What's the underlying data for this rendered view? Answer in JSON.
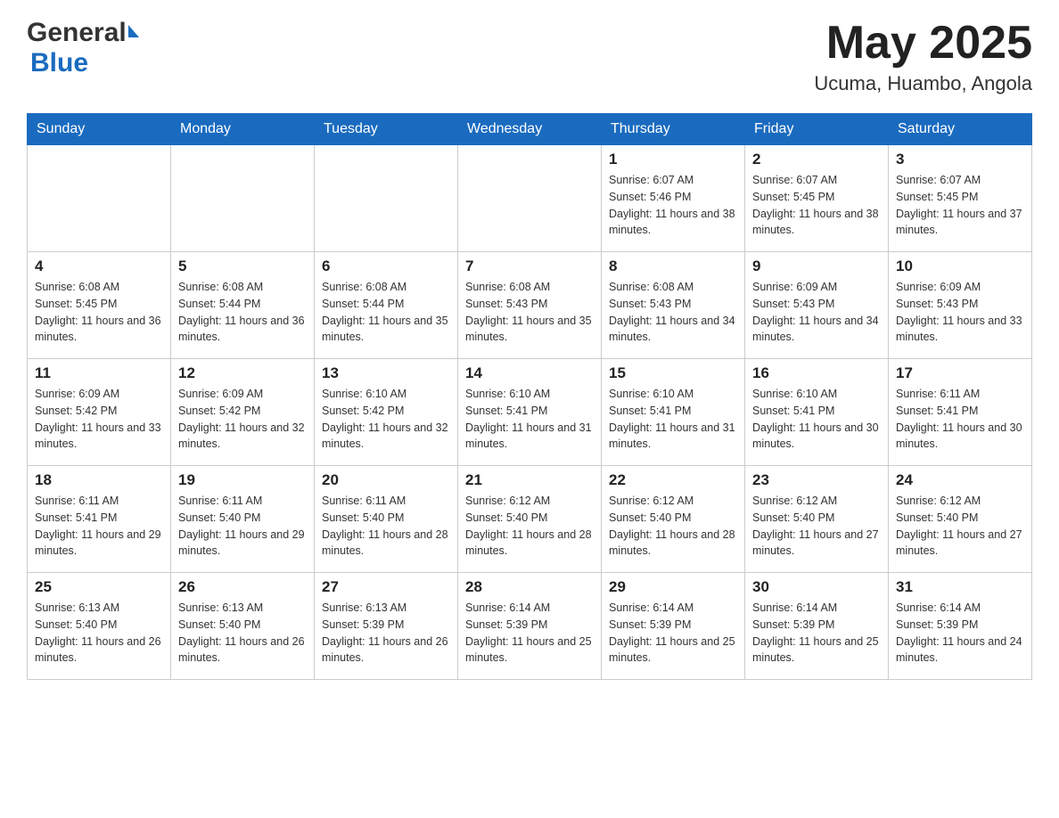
{
  "header": {
    "logo_general": "General",
    "logo_blue": "Blue",
    "month_title": "May 2025",
    "location": "Ucuma, Huambo, Angola"
  },
  "weekdays": [
    "Sunday",
    "Monday",
    "Tuesday",
    "Wednesday",
    "Thursday",
    "Friday",
    "Saturday"
  ],
  "weeks": [
    [
      {
        "day": "",
        "sunrise": "",
        "sunset": "",
        "daylight": ""
      },
      {
        "day": "",
        "sunrise": "",
        "sunset": "",
        "daylight": ""
      },
      {
        "day": "",
        "sunrise": "",
        "sunset": "",
        "daylight": ""
      },
      {
        "day": "",
        "sunrise": "",
        "sunset": "",
        "daylight": ""
      },
      {
        "day": "1",
        "sunrise": "Sunrise: 6:07 AM",
        "sunset": "Sunset: 5:46 PM",
        "daylight": "Daylight: 11 hours and 38 minutes."
      },
      {
        "day": "2",
        "sunrise": "Sunrise: 6:07 AM",
        "sunset": "Sunset: 5:45 PM",
        "daylight": "Daylight: 11 hours and 38 minutes."
      },
      {
        "day": "3",
        "sunrise": "Sunrise: 6:07 AM",
        "sunset": "Sunset: 5:45 PM",
        "daylight": "Daylight: 11 hours and 37 minutes."
      }
    ],
    [
      {
        "day": "4",
        "sunrise": "Sunrise: 6:08 AM",
        "sunset": "Sunset: 5:45 PM",
        "daylight": "Daylight: 11 hours and 36 minutes."
      },
      {
        "day": "5",
        "sunrise": "Sunrise: 6:08 AM",
        "sunset": "Sunset: 5:44 PM",
        "daylight": "Daylight: 11 hours and 36 minutes."
      },
      {
        "day": "6",
        "sunrise": "Sunrise: 6:08 AM",
        "sunset": "Sunset: 5:44 PM",
        "daylight": "Daylight: 11 hours and 35 minutes."
      },
      {
        "day": "7",
        "sunrise": "Sunrise: 6:08 AM",
        "sunset": "Sunset: 5:43 PM",
        "daylight": "Daylight: 11 hours and 35 minutes."
      },
      {
        "day": "8",
        "sunrise": "Sunrise: 6:08 AM",
        "sunset": "Sunset: 5:43 PM",
        "daylight": "Daylight: 11 hours and 34 minutes."
      },
      {
        "day": "9",
        "sunrise": "Sunrise: 6:09 AM",
        "sunset": "Sunset: 5:43 PM",
        "daylight": "Daylight: 11 hours and 34 minutes."
      },
      {
        "day": "10",
        "sunrise": "Sunrise: 6:09 AM",
        "sunset": "Sunset: 5:43 PM",
        "daylight": "Daylight: 11 hours and 33 minutes."
      }
    ],
    [
      {
        "day": "11",
        "sunrise": "Sunrise: 6:09 AM",
        "sunset": "Sunset: 5:42 PM",
        "daylight": "Daylight: 11 hours and 33 minutes."
      },
      {
        "day": "12",
        "sunrise": "Sunrise: 6:09 AM",
        "sunset": "Sunset: 5:42 PM",
        "daylight": "Daylight: 11 hours and 32 minutes."
      },
      {
        "day": "13",
        "sunrise": "Sunrise: 6:10 AM",
        "sunset": "Sunset: 5:42 PM",
        "daylight": "Daylight: 11 hours and 32 minutes."
      },
      {
        "day": "14",
        "sunrise": "Sunrise: 6:10 AM",
        "sunset": "Sunset: 5:41 PM",
        "daylight": "Daylight: 11 hours and 31 minutes."
      },
      {
        "day": "15",
        "sunrise": "Sunrise: 6:10 AM",
        "sunset": "Sunset: 5:41 PM",
        "daylight": "Daylight: 11 hours and 31 minutes."
      },
      {
        "day": "16",
        "sunrise": "Sunrise: 6:10 AM",
        "sunset": "Sunset: 5:41 PM",
        "daylight": "Daylight: 11 hours and 30 minutes."
      },
      {
        "day": "17",
        "sunrise": "Sunrise: 6:11 AM",
        "sunset": "Sunset: 5:41 PM",
        "daylight": "Daylight: 11 hours and 30 minutes."
      }
    ],
    [
      {
        "day": "18",
        "sunrise": "Sunrise: 6:11 AM",
        "sunset": "Sunset: 5:41 PM",
        "daylight": "Daylight: 11 hours and 29 minutes."
      },
      {
        "day": "19",
        "sunrise": "Sunrise: 6:11 AM",
        "sunset": "Sunset: 5:40 PM",
        "daylight": "Daylight: 11 hours and 29 minutes."
      },
      {
        "day": "20",
        "sunrise": "Sunrise: 6:11 AM",
        "sunset": "Sunset: 5:40 PM",
        "daylight": "Daylight: 11 hours and 28 minutes."
      },
      {
        "day": "21",
        "sunrise": "Sunrise: 6:12 AM",
        "sunset": "Sunset: 5:40 PM",
        "daylight": "Daylight: 11 hours and 28 minutes."
      },
      {
        "day": "22",
        "sunrise": "Sunrise: 6:12 AM",
        "sunset": "Sunset: 5:40 PM",
        "daylight": "Daylight: 11 hours and 28 minutes."
      },
      {
        "day": "23",
        "sunrise": "Sunrise: 6:12 AM",
        "sunset": "Sunset: 5:40 PM",
        "daylight": "Daylight: 11 hours and 27 minutes."
      },
      {
        "day": "24",
        "sunrise": "Sunrise: 6:12 AM",
        "sunset": "Sunset: 5:40 PM",
        "daylight": "Daylight: 11 hours and 27 minutes."
      }
    ],
    [
      {
        "day": "25",
        "sunrise": "Sunrise: 6:13 AM",
        "sunset": "Sunset: 5:40 PM",
        "daylight": "Daylight: 11 hours and 26 minutes."
      },
      {
        "day": "26",
        "sunrise": "Sunrise: 6:13 AM",
        "sunset": "Sunset: 5:40 PM",
        "daylight": "Daylight: 11 hours and 26 minutes."
      },
      {
        "day": "27",
        "sunrise": "Sunrise: 6:13 AM",
        "sunset": "Sunset: 5:39 PM",
        "daylight": "Daylight: 11 hours and 26 minutes."
      },
      {
        "day": "28",
        "sunrise": "Sunrise: 6:14 AM",
        "sunset": "Sunset: 5:39 PM",
        "daylight": "Daylight: 11 hours and 25 minutes."
      },
      {
        "day": "29",
        "sunrise": "Sunrise: 6:14 AM",
        "sunset": "Sunset: 5:39 PM",
        "daylight": "Daylight: 11 hours and 25 minutes."
      },
      {
        "day": "30",
        "sunrise": "Sunrise: 6:14 AM",
        "sunset": "Sunset: 5:39 PM",
        "daylight": "Daylight: 11 hours and 25 minutes."
      },
      {
        "day": "31",
        "sunrise": "Sunrise: 6:14 AM",
        "sunset": "Sunset: 5:39 PM",
        "daylight": "Daylight: 11 hours and 24 minutes."
      }
    ]
  ]
}
